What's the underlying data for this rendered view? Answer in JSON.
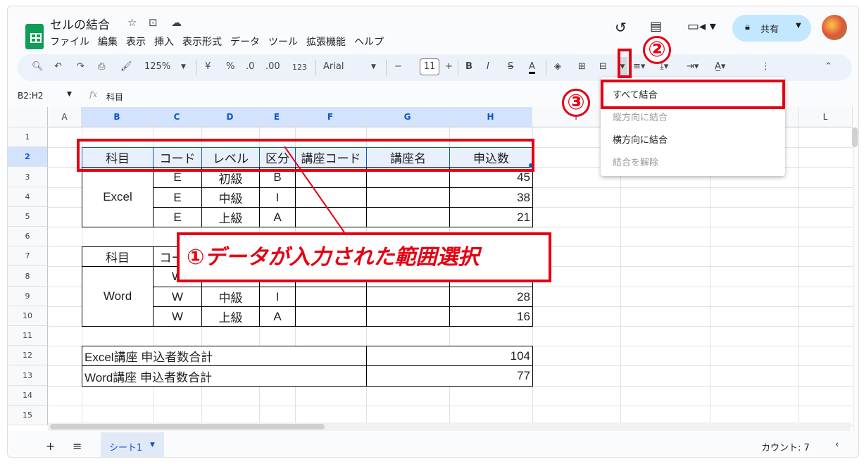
{
  "header": {
    "title": "セルの結合",
    "menu": [
      "ファイル",
      "編集",
      "表示",
      "挿入",
      "表示形式",
      "データ",
      "ツール",
      "拡張機能",
      "ヘルプ"
    ],
    "share_label": "共有"
  },
  "toolbar": {
    "zoom": "125%",
    "currency": "¥",
    "percent": "%",
    "dec_less": ".0",
    "dec_more": ".00",
    "format_123": "123",
    "font": "Arial",
    "font_size": "11",
    "bold": "B",
    "italic": "I",
    "strike": "S",
    "text_color": "A"
  },
  "formula_bar": {
    "name_box": "B2:H2",
    "fx": "fx",
    "value": "科目"
  },
  "columns": [
    "A",
    "B",
    "C",
    "D",
    "E",
    "F",
    "G",
    "H",
    "I",
    "J",
    "K",
    "L"
  ],
  "rows": [
    "1",
    "2",
    "3",
    "4",
    "5",
    "6",
    "7",
    "8",
    "9",
    "10",
    "11",
    "12",
    "13",
    "14",
    "15"
  ],
  "cells": {
    "B2": "科目",
    "C2": "コード",
    "D2": "レベル",
    "E2": "区分",
    "F2": "講座コード",
    "G2": "講座名",
    "H2": "申込数",
    "B3": "Excel",
    "C3": "E",
    "D3": "初級",
    "E3": "B",
    "H3": "45",
    "C4": "E",
    "D4": "中級",
    "E4": "I",
    "H4": "38",
    "C5": "E",
    "D5": "上級",
    "E5": "A",
    "H5": "21",
    "B7": "科目",
    "C7": "コード",
    "B8": "Word",
    "C8": "W",
    "C9": "W",
    "D9": "中級",
    "E9": "I",
    "H9": "28",
    "C10": "W",
    "D10": "上級",
    "E10": "A",
    "H10": "16",
    "B12": "Excel講座 申込者数合計",
    "G12": "104",
    "B13": "Word講座 申込者数合計",
    "G13": "77"
  },
  "merge_menu": {
    "items": [
      {
        "label": "すべて結合",
        "enabled": true
      },
      {
        "label": "縦方向に結合",
        "enabled": false
      },
      {
        "label": "横方向に結合",
        "enabled": true
      },
      {
        "label": "結合を解除",
        "enabled": false
      }
    ]
  },
  "annotations": {
    "step1": "①データが入力された範囲選択",
    "step2": "②",
    "step3": "③",
    "color": "#e50012"
  },
  "bottom": {
    "add": "+",
    "list": "≡",
    "sheet_tab": "シート1",
    "count": "カウント: 7"
  }
}
